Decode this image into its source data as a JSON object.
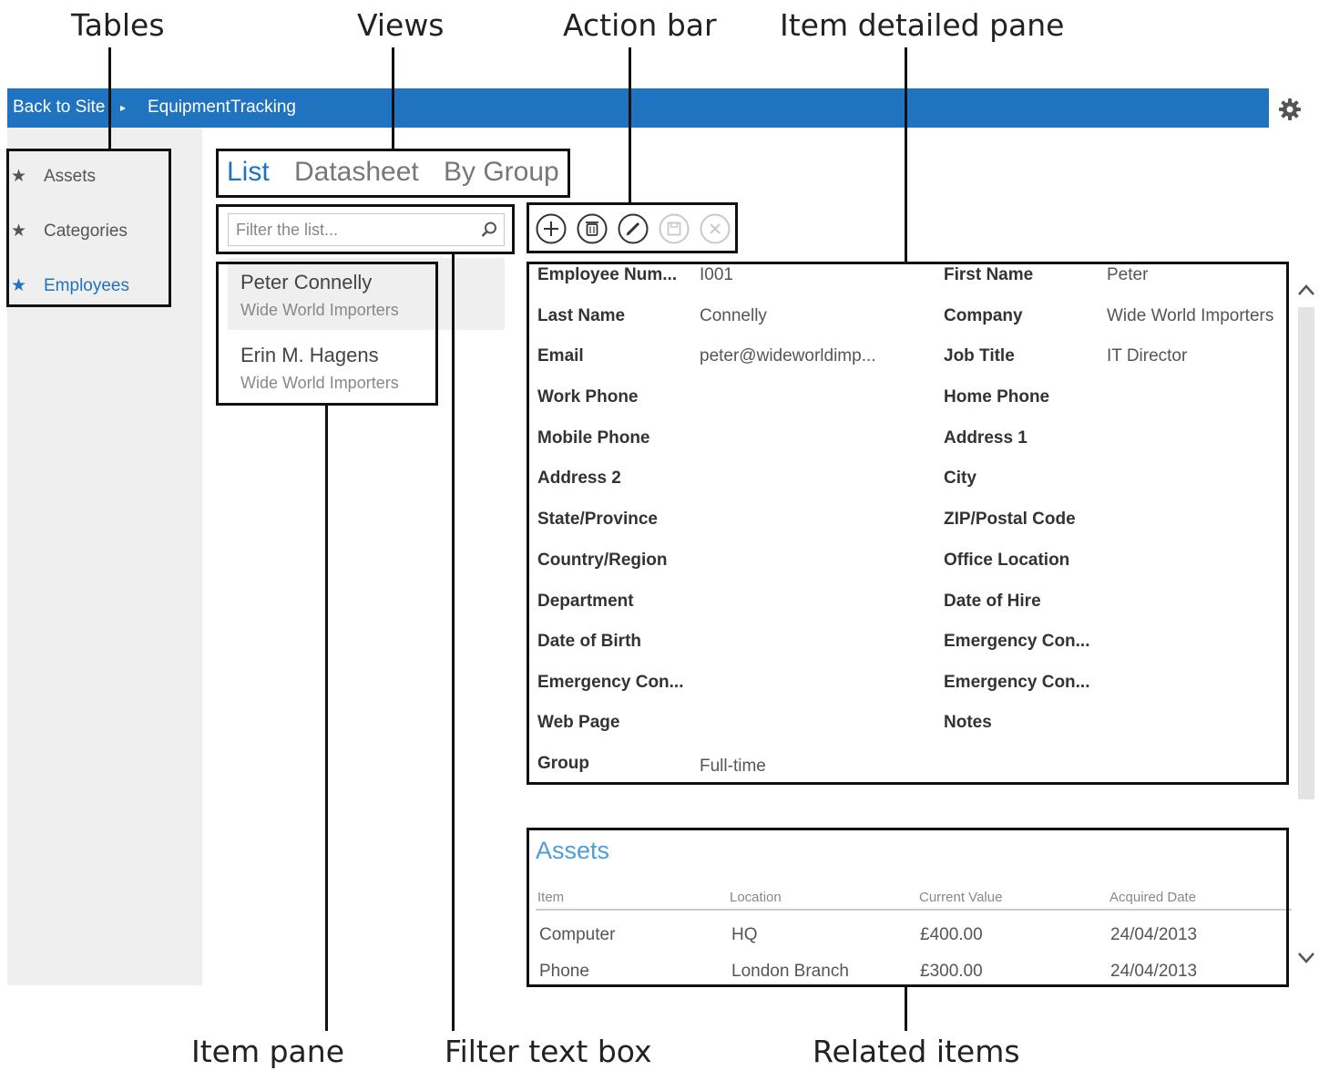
{
  "callouts": {
    "tables": "Tables",
    "views": "Views",
    "action_bar": "Action bar",
    "item_detailed_pane": "Item detailed pane",
    "item_pane": "Item pane",
    "filter_text_box": "Filter text box",
    "related_items": "Related items"
  },
  "topbar": {
    "back_label": "Back to Site",
    "separator": "▸",
    "app_name": "EquipmentTracking",
    "settings_icon": "gear-icon"
  },
  "nav": {
    "items": [
      {
        "label": "Assets",
        "icon": "star-icon"
      },
      {
        "label": "Categories",
        "icon": "star-icon"
      },
      {
        "label": "Employees",
        "icon": "star-icon",
        "active": true
      }
    ]
  },
  "views": {
    "tabs": [
      {
        "label": "List",
        "active": true
      },
      {
        "label": "Datasheet"
      },
      {
        "label": "By Group"
      }
    ]
  },
  "filter": {
    "placeholder": "Filter the list...",
    "icon": "search-icon"
  },
  "action_bar": {
    "buttons": [
      {
        "name": "add",
        "icon": "plus-icon",
        "enabled": true
      },
      {
        "name": "delete",
        "icon": "trash-icon",
        "enabled": true
      },
      {
        "name": "edit",
        "icon": "pencil-icon",
        "enabled": true
      },
      {
        "name": "save",
        "icon": "save-icon",
        "enabled": false
      },
      {
        "name": "cancel",
        "icon": "close-icon",
        "enabled": false
      }
    ]
  },
  "items": [
    {
      "title": "Peter Connelly",
      "subtitle": "Wide World Importers",
      "selected": true
    },
    {
      "title": "Erin M. Hagens",
      "subtitle": "Wide World Importers"
    }
  ],
  "detail": {
    "left": [
      {
        "label": "Employee Num...",
        "value": "I001"
      },
      {
        "label": "Last Name",
        "value": "Connelly"
      },
      {
        "label": "Email",
        "value": "peter@wideworldimp..."
      },
      {
        "label": "Work Phone",
        "value": ""
      },
      {
        "label": "Mobile Phone",
        "value": ""
      },
      {
        "label": "Address 2",
        "value": ""
      },
      {
        "label": "State/Province",
        "value": ""
      },
      {
        "label": "Country/Region",
        "value": ""
      },
      {
        "label": "Department",
        "value": ""
      },
      {
        "label": "Date of Birth",
        "value": ""
      },
      {
        "label": "Emergency Con...",
        "value": ""
      },
      {
        "label": "Web Page",
        "value": ""
      },
      {
        "label": "Group",
        "value": "Full-time"
      }
    ],
    "right": [
      {
        "label": "First Name",
        "value": "Peter"
      },
      {
        "label": "Company",
        "value": "Wide World Importers"
      },
      {
        "label": "Job Title",
        "value": "IT Director"
      },
      {
        "label": "Home Phone",
        "value": ""
      },
      {
        "label": "Address 1",
        "value": ""
      },
      {
        "label": "City",
        "value": ""
      },
      {
        "label": "ZIP/Postal Code",
        "value": ""
      },
      {
        "label": "Office Location",
        "value": ""
      },
      {
        "label": "Date of Hire",
        "value": ""
      },
      {
        "label": "Emergency Con...",
        "value": ""
      },
      {
        "label": "Emergency Con...",
        "value": ""
      },
      {
        "label": "Notes",
        "value": ""
      }
    ]
  },
  "related": {
    "title": "Assets",
    "columns": [
      "Item",
      "Location",
      "Current Value",
      "Acquired Date"
    ],
    "rows": [
      [
        "Computer",
        "HQ",
        "£400.00",
        "24/04/2013"
      ],
      [
        "Phone",
        "London Branch",
        "£300.00",
        "24/04/2013"
      ]
    ]
  },
  "scrollbar": {
    "up_icon": "chevron-up-icon",
    "down_icon": "chevron-down-icon"
  },
  "colors": {
    "accent": "#1f73bf",
    "related_title": "#4a9fd6",
    "nav_bg": "#efefef"
  }
}
